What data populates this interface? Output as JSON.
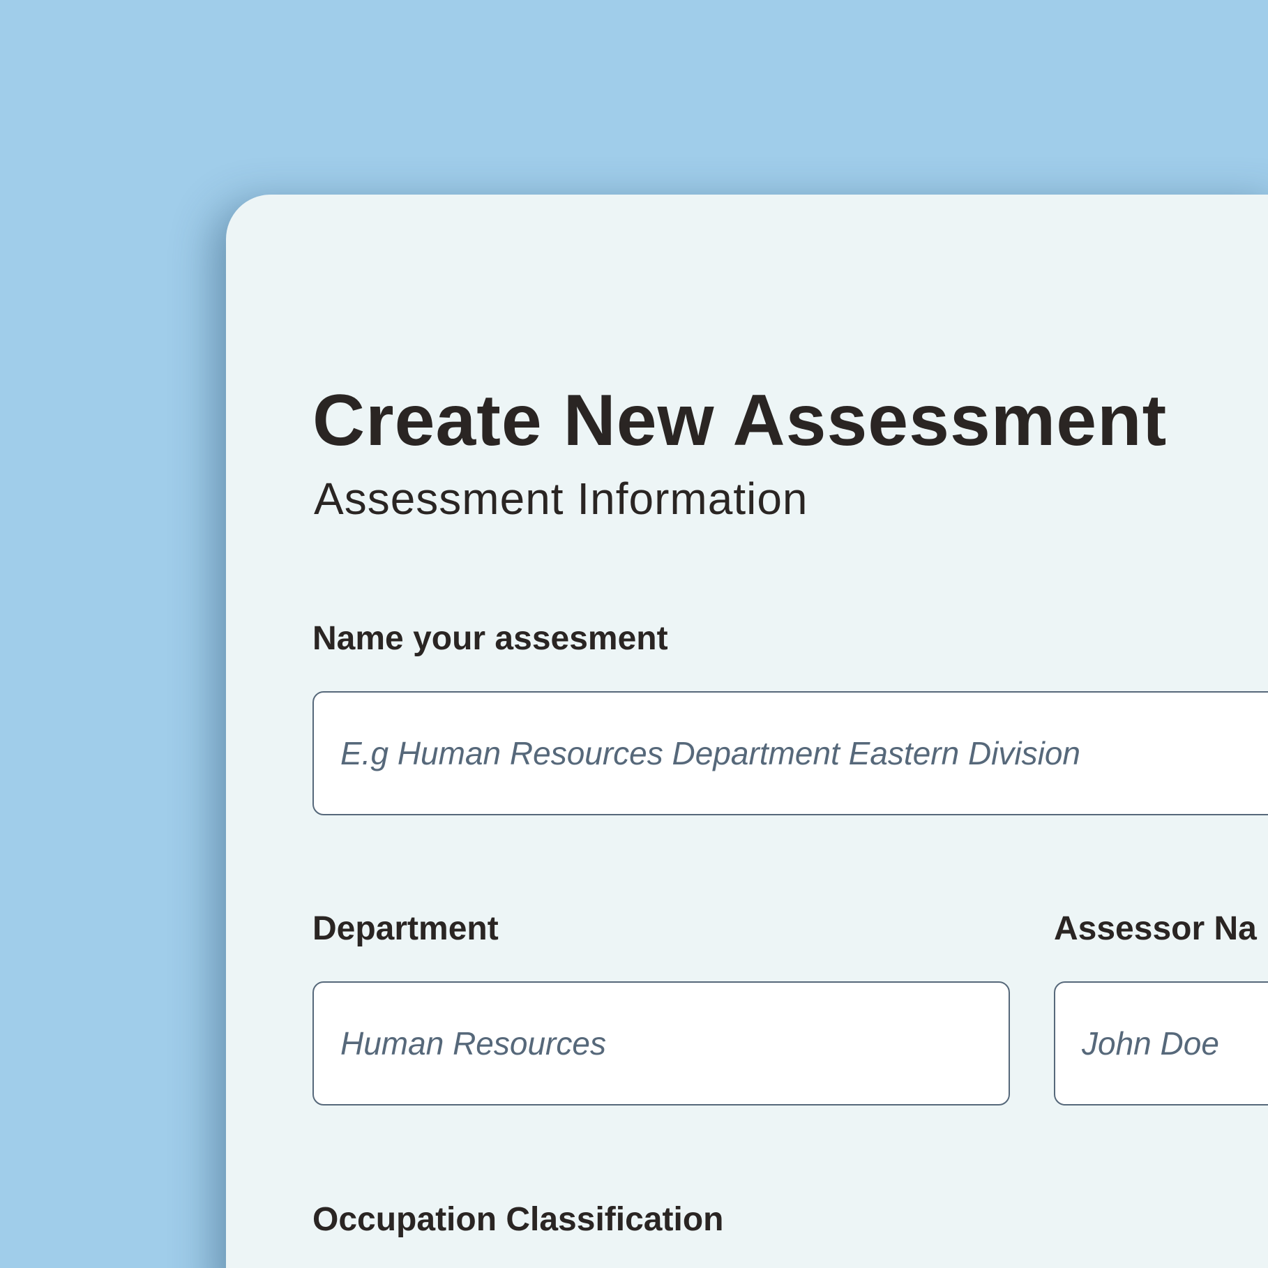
{
  "form": {
    "title": "Create New Assessment",
    "subtitle": "Assessment Information",
    "fields": {
      "assessment_name": {
        "label": "Name your assesment",
        "placeholder": "E.g Human Resources Department Eastern Division"
      },
      "department": {
        "label": "Department",
        "placeholder": "Human Resources"
      },
      "assessor_name": {
        "label": "Assessor Na",
        "placeholder": "John Doe"
      },
      "occupation_classification": {
        "label": "Occupation Classification"
      }
    }
  },
  "colors": {
    "page_background": "#a0cdea",
    "card_background": "#edf5f6",
    "text_primary": "#2a2523",
    "input_border": "#56687a",
    "placeholder_text": "#56687a",
    "input_background": "#ffffff"
  }
}
